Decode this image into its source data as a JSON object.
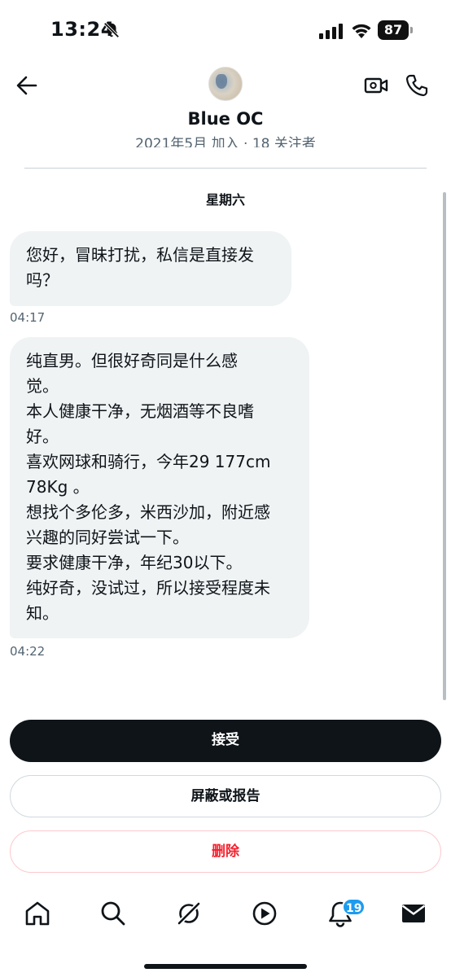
{
  "status_bar": {
    "time": "13:24",
    "battery": "87",
    "icons": [
      "bell-off-icon",
      "cellular-signal-icon",
      "wifi-icon",
      "battery-icon"
    ]
  },
  "header": {
    "contact_name": "Blue OC",
    "contact_meta": "2021年5月 加入 · 18 关注者",
    "icons": [
      "back-arrow-icon",
      "video-call-icon",
      "phone-call-icon"
    ]
  },
  "conversation": {
    "day_label": "星期六",
    "messages": [
      {
        "lines": [
          "您好，冒昧打扰，私信是直接发",
          "吗？"
        ],
        "time": "04:17"
      },
      {
        "lines": [
          "纯直男。但很好奇同是什么感",
          "觉。",
          "本人健康干净，无烟酒等不良嗜",
          "好。",
          "喜欢网球和骑行，今年29 177cm",
          "78Kg 。",
          "想找个多伦多，米西沙加，附近感",
          "兴趣的同好尝试一下。",
          "要求健康干净，年纪30以下。",
          "纯好奇，没试过，所以接受程度未",
          "知。"
        ],
        "time": "04:22"
      }
    ]
  },
  "actions": {
    "accept": "接受",
    "block_report": "屏蔽或报告",
    "delete": "删除"
  },
  "bottom_nav": {
    "items": [
      "home-icon",
      "search-icon",
      "grok-icon",
      "video-play-icon",
      "notifications-icon",
      "messages-icon"
    ],
    "notification_badge": "19"
  },
  "colors": {
    "bubble": "#eff3f4",
    "primary_button": "#0f1419",
    "delete_text": "#f4212e",
    "badge": "#1d9bf0",
    "secondary_text": "#536471"
  }
}
